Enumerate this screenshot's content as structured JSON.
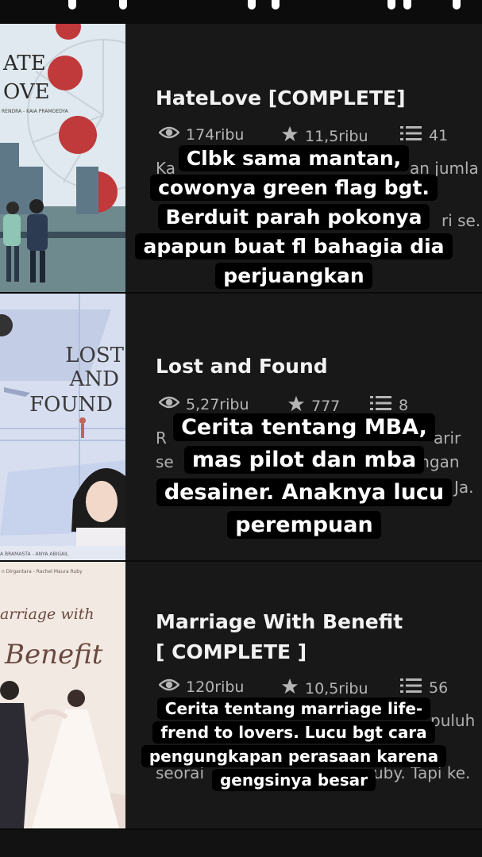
{
  "books": [
    {
      "title": "HateLove  [COMPLETE]",
      "title_line2": "",
      "views": "174ribu",
      "votes": "11,5ribu",
      "parts": "41",
      "desc_left": "Ka",
      "desc_right": "an jumla",
      "desc_left2": "",
      "desc_right2": "ri se.",
      "cover_title_a": "ATE",
      "cover_title_b": "OVE",
      "cover_authors": "RENDRA - KAIA PRAMOEDYA",
      "caption": "Clbk sama mantan, cowonya green flag bgt. Berduit parah pokonya apapun buat fl bahagia dia perjuangkan"
    },
    {
      "title": "Lost and Found",
      "title_line2": "",
      "views": "5,27ribu",
      "votes": "777",
      "parts": "8",
      "desc_left": "R",
      "desc_right": "arir",
      "desc_left2": "se",
      "desc_right2": "angan",
      "desc_right3": "Ja.",
      "cover_title_a": "LOST",
      "cover_title_b": "AND",
      "cover_title_c": "FOUND",
      "cover_authors": "A BRAMASTA - ANYA ABIGAIL",
      "caption": "Cerita tentang MBA, mas pilot dan mba desainer. Anaknya lucu perempuan"
    },
    {
      "title": "Marriage With Benefit",
      "title_line2": "[ COMPLETE ]",
      "views": "120ribu",
      "votes": "10,5ribu",
      "parts": "56",
      "desc_right": "puluh",
      "desc_left2": "seorai",
      "desc_right2": "uby. Tapi ke.",
      "cover_title_a": "arriage with",
      "cover_title_b": "Benefit",
      "cover_authors": "n Dirgantara - Rachel Maura Ruby",
      "caption": "Cerita tentang marriage life- frend to lovers. Lucu bgt cara pengungkapan perasaan karena gengsinya besar"
    }
  ]
}
